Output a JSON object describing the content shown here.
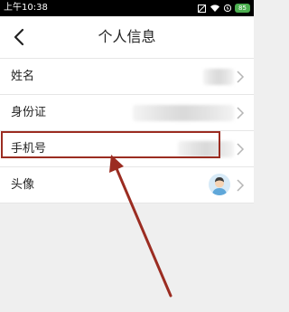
{
  "status_bar": {
    "time": "上午10:38",
    "battery": "85",
    "icons": [
      "sim-signal-icon",
      "wifi-icon",
      "battery-icon"
    ]
  },
  "nav": {
    "title": "个人信息",
    "back_icon": "back-arrow-icon"
  },
  "rows": [
    {
      "label": "姓名",
      "value": "",
      "value_obscured": true
    },
    {
      "label": "身份证",
      "value": "",
      "value_obscured": true
    },
    {
      "label": "手机号",
      "value": "",
      "value_obscured": true
    },
    {
      "label": "头像",
      "value_icon": "user-avatar"
    }
  ],
  "annotation": {
    "highlighted_row": "手机号",
    "color": "#9b2c21"
  },
  "colors": {
    "page_background": "#efefef",
    "row_background": "#ffffff",
    "status_bar": "#000000",
    "battery": "#4caf50"
  }
}
